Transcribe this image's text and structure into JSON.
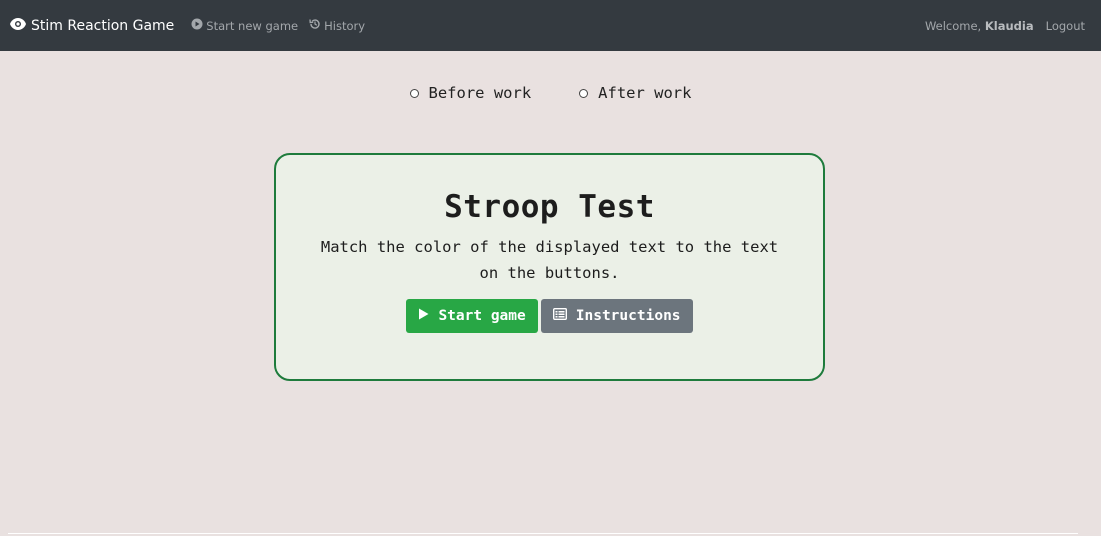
{
  "navbar": {
    "brand": "Stim Reaction Game",
    "links": [
      {
        "label": "Start new game",
        "icon": "play-circle-icon"
      },
      {
        "label": "History",
        "icon": "history-icon"
      }
    ],
    "welcome_prefix": "Welcome,",
    "username": "Klaudia",
    "logout": "Logout"
  },
  "mode_options": [
    {
      "label": "Before work",
      "selected": false
    },
    {
      "label": "After work",
      "selected": false
    }
  ],
  "card": {
    "title": "Stroop Test",
    "subtitle": "Match the color of the displayed text to the text on the buttons.",
    "start_label": "Start game",
    "instructions_label": "Instructions"
  },
  "colors": {
    "navbar": "#343a40",
    "background": "#e9e1e0",
    "card_border": "#1e7b3c",
    "card_bg": "#ebf0e7",
    "start_button": "#28a745",
    "instructions_button": "#6c757d"
  }
}
